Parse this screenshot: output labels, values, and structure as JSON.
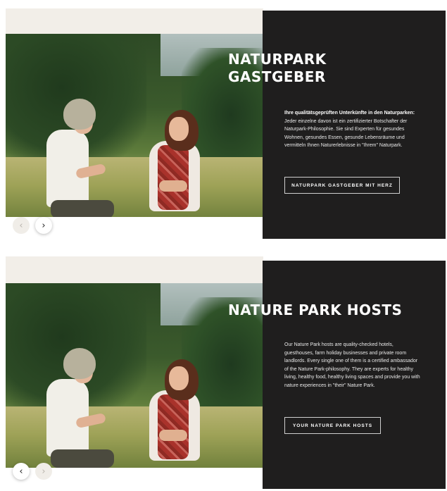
{
  "panels": [
    {
      "title": "NATURPARK GASTGEBER",
      "title_line1": "NATURPARK",
      "title_line2": "GASTGEBER",
      "body_bold": "Ihre qualitätsgeprüften Unterkünfte in den Naturparken:",
      "body_rest": " Jeder einzelne davon ist ein zertifizierter Botschafter der Naturpark-Philosophie. Sie sind Experten für gesundes Wohnen, gesundes Essen, gesunde Lebensräume und vermitteln Ihnen Naturerlebnisse in \"Ihrem\" Naturpark.",
      "cta_label": "NATURPARK GASTGEBER MIT HERZ",
      "prev_arrow": "‹",
      "next_arrow": "›"
    },
    {
      "title": "NATURE PARK HOSTS",
      "body": "Our Nature Park hosts are quality-checked hotels, guesthouses, farm holiday businesses and private room landlords. Every single one of them is a certified ambassador of the Nature Park-philosophy. They are experts for healthy living, healthy food, healthy living spaces and provide you with nature experiences in \"their\" Nature Park.",
      "cta_label": "YOUR NATURE PARK HOSTS",
      "prev_arrow": "‹",
      "next_arrow": "›"
    }
  ],
  "colors": {
    "dark_box": "#1f1e1e",
    "beige_band": "#f2eee8",
    "text": "#ffffff"
  },
  "icons": {
    "prev": "chevron-left-icon",
    "next": "chevron-right-icon"
  }
}
